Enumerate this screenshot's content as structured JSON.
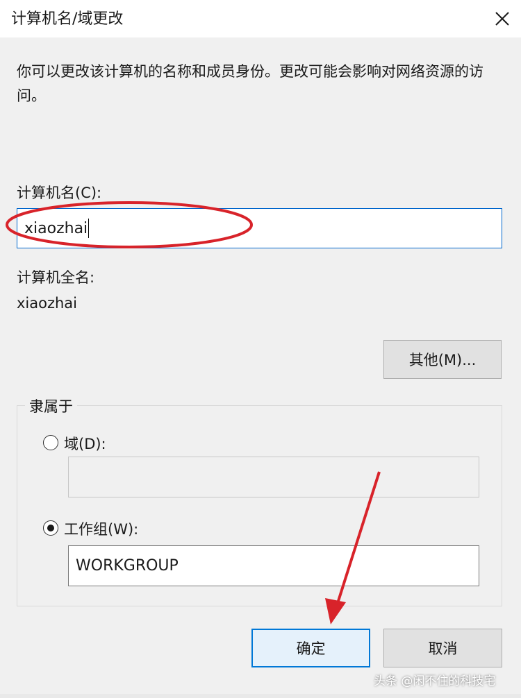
{
  "window": {
    "title": "计算机名/域更改",
    "close_icon": "close-icon"
  },
  "description": "你可以更改该计算机的名称和成员身份。更改可能会影响对网络资源的访问。",
  "computer_name": {
    "label": "计算机名(C):",
    "value": "xiaozhai"
  },
  "full_name": {
    "label": "计算机全名:",
    "value": "xiaozhai"
  },
  "buttons": {
    "more": "其他(M)...",
    "ok": "确定",
    "cancel": "取消"
  },
  "member_of": {
    "title": "隶属于",
    "domain": {
      "label": "域(D):",
      "value": "",
      "selected": false
    },
    "workgroup": {
      "label": "工作组(W):",
      "value": "WORKGROUP",
      "selected": true
    }
  },
  "annotations": {
    "highlight_color": "#d8232a",
    "arrow_color": "#d8232a"
  },
  "watermark": "头条 @闲不住的科技宅",
  "colors": {
    "accent": "#0078d7",
    "window_bg": "#f0f0f0",
    "titlebar_bg": "#ffffff"
  }
}
